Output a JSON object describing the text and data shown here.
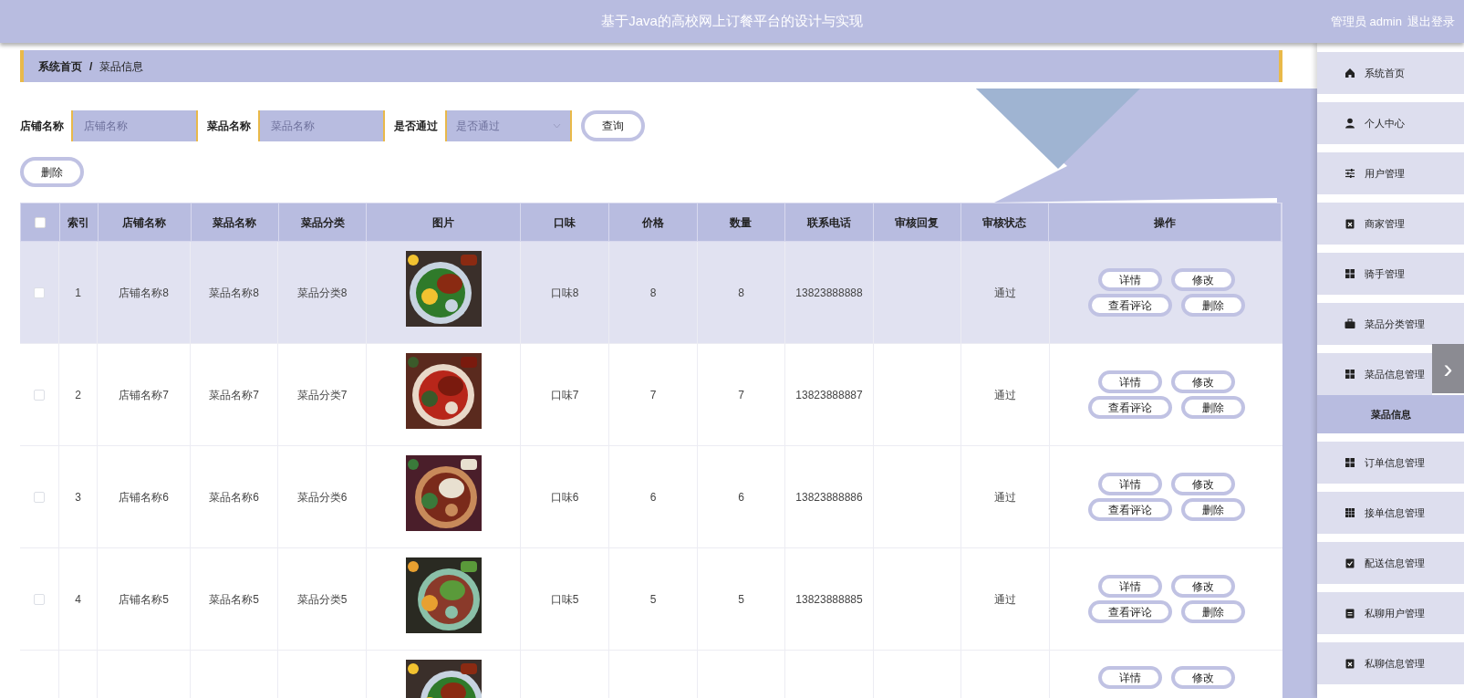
{
  "header": {
    "title": "基于Java的高校网上订餐平台的设计与实现",
    "user": "管理员 admin",
    "logout": "退出登录"
  },
  "breadcrumb": [
    "系统首页",
    "菜品信息"
  ],
  "breadcrumb_separator": "/",
  "filters": [
    {
      "kind": "input",
      "label": "店铺名称",
      "placeholder": "店铺名称"
    },
    {
      "kind": "input",
      "label": "菜品名称",
      "placeholder": "菜品名称"
    },
    {
      "kind": "select",
      "label": "是否通过",
      "placeholder": "是否通过"
    }
  ],
  "search_button": "查询",
  "delete_button": "删除",
  "table": {
    "select_all_checked": false,
    "columns": [
      "索引",
      "店铺名称",
      "菜品名称",
      "菜品分类",
      "图片",
      "口味",
      "价格",
      "数量",
      "联系电话",
      "审核回复",
      "审核状态",
      "操作"
    ],
    "rows": [
      {
        "highlighted": true,
        "checked": false,
        "cells": [
          "1",
          "店铺名称8",
          "菜品名称8",
          "菜品分类8",
          null,
          "口味8",
          "8",
          "8",
          "13823888888",
          null,
          "通过"
        ],
        "actions": [
          "详情",
          "修改",
          "查看评论",
          "删除"
        ]
      },
      {
        "highlighted": false,
        "checked": false,
        "cells": [
          "2",
          "店铺名称7",
          "菜品名称7",
          "菜品分类7",
          null,
          "口味7",
          "7",
          "7",
          "13823888887",
          null,
          "通过"
        ],
        "actions": [
          "详情",
          "修改",
          "查看评论",
          "删除"
        ]
      },
      {
        "highlighted": false,
        "checked": false,
        "cells": [
          "3",
          "店铺名称6",
          "菜品名称6",
          "菜品分类6",
          null,
          "口味6",
          "6",
          "6",
          "13823888886",
          null,
          "通过"
        ],
        "actions": [
          "详情",
          "修改",
          "查看评论",
          "删除"
        ]
      },
      {
        "highlighted": false,
        "checked": false,
        "cells": [
          "4",
          "店铺名称5",
          "菜品名称5",
          "菜品分类5",
          null,
          "口味5",
          "5",
          "5",
          "13823888885",
          null,
          "通过"
        ],
        "actions": [
          "详情",
          "修改",
          "查看评论",
          "删除"
        ]
      },
      {
        "highlighted": false,
        "cells": [],
        "actions": [
          "详情",
          "修改"
        ]
      }
    ]
  },
  "sidebar": {
    "items": [
      {
        "label": "系统首页"
      },
      {
        "label": "个人中心"
      },
      {
        "label": "用户管理"
      },
      {
        "label": "商家管理"
      },
      {
        "label": "骑手管理"
      },
      {
        "label": "菜品分类管理"
      },
      {
        "label": "菜品信息管理",
        "children": [
          {
            "label": "菜品信息",
            "selected": true
          }
        ]
      },
      {
        "label": "订单信息管理"
      },
      {
        "label": "接单信息管理"
      },
      {
        "label": "配送信息管理"
      },
      {
        "label": "私聊用户管理"
      },
      {
        "label": "私聊信息管理"
      }
    ]
  },
  "next_button": "›"
}
